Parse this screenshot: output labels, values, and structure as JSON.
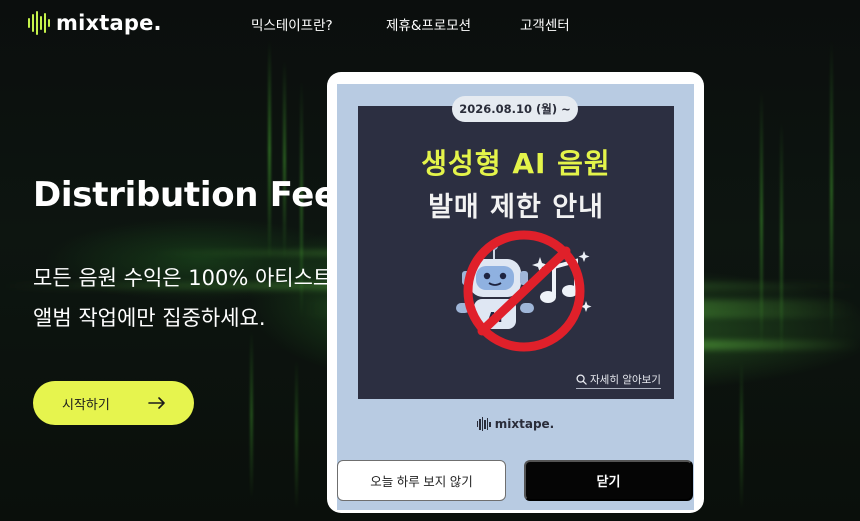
{
  "header": {
    "logo_text": "mixtape.",
    "nav": [
      "믹스테이프란?",
      "제휴&프로모션",
      "고객센터"
    ]
  },
  "hero": {
    "title": "Distribution Fee C",
    "subtitle_line1": "모든 음원 수익은 100% 아티스트",
    "subtitle_line2": "앨범 작업에만 집중하세요.",
    "start_button": "시작하기",
    "accent_color": "#e6f44e"
  },
  "modal": {
    "banner": {
      "date": "2026.08.10 (월) ~",
      "headline1": "생성형 AI 음원",
      "headline2": "발매 제한 안내",
      "robot_badge": "AI",
      "more_link": "자세히 알아보기",
      "logo_text": "mixtape.",
      "headline_color": "#e4f44a",
      "prohibit_color": "#e0202a"
    },
    "hide_today_button": "오늘 하루 보지 않기",
    "close_button": "닫기"
  }
}
